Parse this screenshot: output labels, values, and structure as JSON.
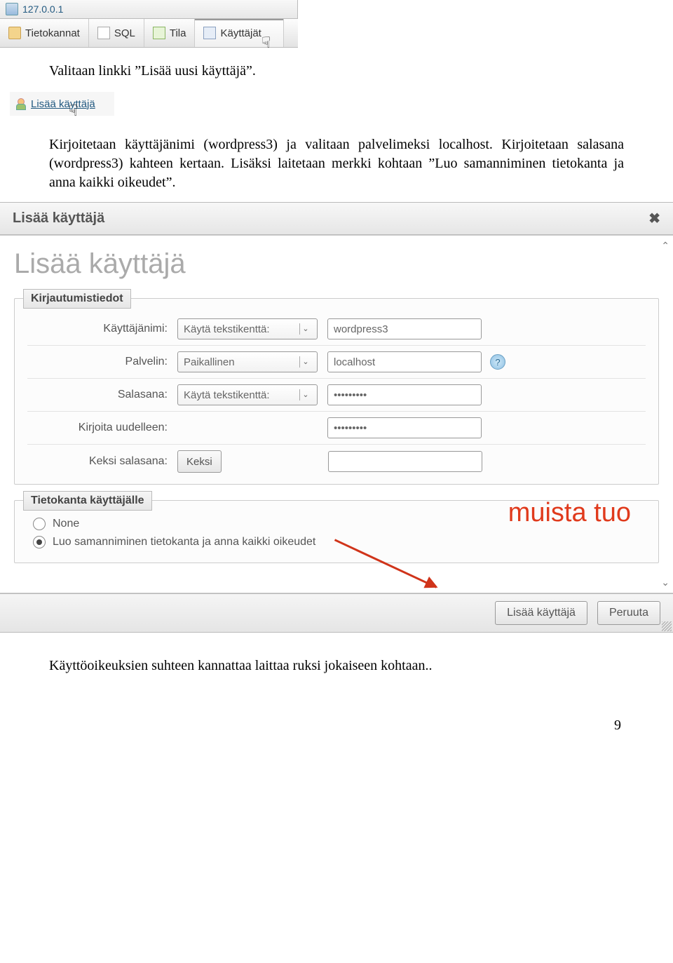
{
  "topnav": {
    "server_label": "127.0.0.1",
    "tabs": [
      "Tietokannat",
      "SQL",
      "Tila",
      "Käyttäjät"
    ]
  },
  "doc": {
    "p1": "Valitaan linkki ”Lisää uusi käyttäjä”.",
    "p2": "Kirjoitetaan käyttäjänimi (wordpress3) ja valitaan palvelimeksi localhost. Kirjoitetaan salasana (wordpress3) kahteen kertaan. Lisäksi laitetaan merkki kohtaan ”Luo samanniminen tietokanta ja anna kaikki oikeudet”.",
    "p3": "Käyttöoikeuksien suhteen kannattaa laittaa ruksi jokaiseen kohtaan..",
    "pagenum": "9"
  },
  "adduser_link": {
    "text": "Lisää käyttäjä"
  },
  "dialog": {
    "title": "Lisää käyttäjä",
    "heading": "Lisää käyttäjä",
    "legend_login": "Kirjautumistiedot",
    "rows": {
      "username_label": "Käyttäjänimi:",
      "username_mode": "Käytä tekstikenttä:",
      "username_value": "wordpress3",
      "host_label": "Palvelin:",
      "host_mode": "Paikallinen",
      "host_value": "localhost",
      "password_label": "Salasana:",
      "password_mode": "Käytä tekstikenttä:",
      "password_value": "•••••••••",
      "retype_label": "Kirjoita uudelleen:",
      "retype_value": "•••••••••",
      "gen_label": "Keksi salasana:",
      "gen_button": "Keksi"
    },
    "legend_db": "Tietokanta käyttäjälle",
    "opt_none": "None",
    "opt_create": "Luo samanniminen tietokanta ja anna kaikki oikeudet",
    "remember": "muista tuo",
    "btn_submit": "Lisää käyttäjä",
    "btn_cancel": "Peruuta"
  }
}
